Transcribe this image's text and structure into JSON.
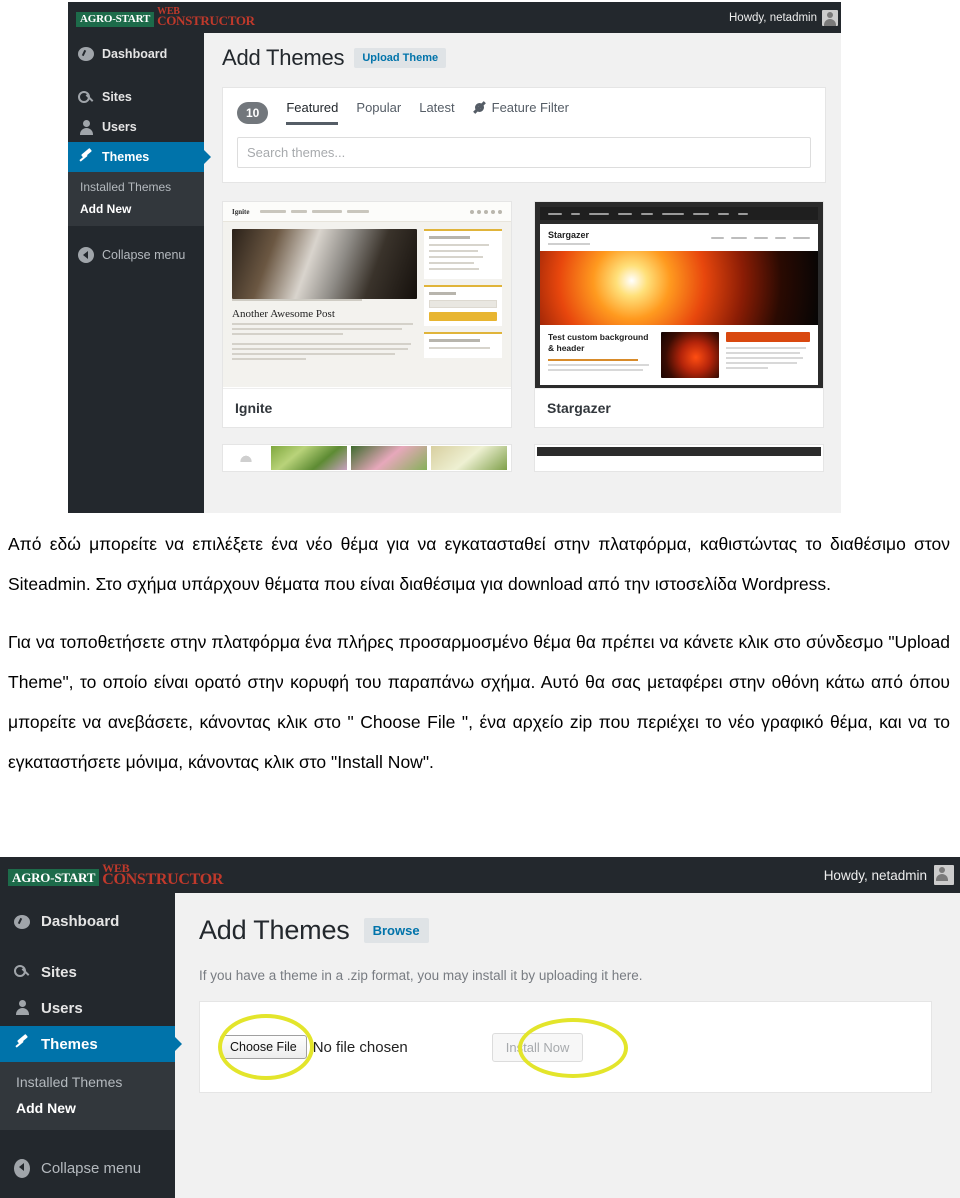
{
  "top_screenshot": {
    "adminbar": {
      "brand_badge": "AGRO-START",
      "brand_line1": "WEB",
      "brand_line2": "CONSTRUCTOR",
      "howdy": "Howdy, netadmin",
      "avatar_icon": "user-avatar-icon"
    },
    "sidebar": {
      "items": [
        {
          "label": "Dashboard",
          "icon": "dashboard-icon",
          "active": false
        },
        {
          "label": "Sites",
          "icon": "key-icon",
          "active": false
        },
        {
          "label": "Users",
          "icon": "users-icon",
          "active": false
        },
        {
          "label": "Themes",
          "icon": "pin-icon",
          "active": true
        }
      ],
      "submenu": [
        {
          "label": "Installed Themes",
          "current": false
        },
        {
          "label": "Add New",
          "current": true
        }
      ],
      "collapse": {
        "label": "Collapse menu",
        "icon": "collapse-arrow-icon"
      }
    },
    "page_title": "Add Themes",
    "page_action": "Upload Theme",
    "count_badge": "10",
    "tabs": [
      {
        "label": "Featured",
        "active": true
      },
      {
        "label": "Popular",
        "active": false
      },
      {
        "label": "Latest",
        "active": false
      }
    ],
    "feature_filter": {
      "label": "Feature Filter",
      "icon": "gear-icon"
    },
    "search_placeholder": "Search themes...",
    "themes": [
      {
        "name": "Ignite",
        "preview_logo": "Ignite",
        "preview_headline": "Another Awesome Post"
      },
      {
        "name": "Stargazer",
        "preview_logo": "Stargazer",
        "preview_headline": "Test custom background & header"
      }
    ]
  },
  "body_text": {
    "paragraph1": "Από εδώ μπορείτε να επιλέξετε ένα νέο θέμα για να εγκατασταθεί στην πλατφόρμα, καθιστώντας το διαθέσιμο στον Siteadmin. Στο σχήμα υπάρχουν θέματα που είναι διαθέσιμα για download από την ιστοσελίδα Wordpress.",
    "paragraph2": "Για να τοποθετήσετε στην πλατφόρμα ένα πλήρες προσαρμοσμένο θέμα θα πρέπει να κάνετε κλικ στο σύνδεσμο \"Upload Theme\", το οποίο είναι ορατό στην κορυφή του παραπάνω σχήμα. Αυτό θα σας μεταφέρει στην οθόνη κάτω από όπου μπορείτε να ανεβάσετε, κάνοντας κλικ στο \" Choose File \", ένα αρχείο zip που περιέχει το νέο γραφικό θέμα, και να το εγκαταστήσετε μόνιμα, κάνοντας κλικ στο \"Install Now\"."
  },
  "bottom_screenshot": {
    "adminbar": {
      "brand_badge": "AGRO-START",
      "brand_line1": "WEB",
      "brand_line2": "CONSTRUCTOR",
      "howdy": "Howdy, netadmin",
      "avatar_icon": "user-avatar-icon"
    },
    "sidebar": {
      "items": [
        {
          "label": "Dashboard",
          "icon": "dashboard-icon",
          "active": false
        },
        {
          "label": "Sites",
          "icon": "key-icon",
          "active": false
        },
        {
          "label": "Users",
          "icon": "users-icon",
          "active": false
        },
        {
          "label": "Themes",
          "icon": "pin-icon",
          "active": true
        }
      ],
      "submenu": [
        {
          "label": "Installed Themes",
          "current": false
        },
        {
          "label": "Add New",
          "current": true
        }
      ],
      "collapse": {
        "label": "Collapse menu",
        "icon": "collapse-arrow-icon"
      }
    },
    "page_title": "Add Themes",
    "page_action": "Browse",
    "note": "If you have a theme in a .zip format, you may install it by uploading it here.",
    "choose_file_button": "Choose File",
    "file_status": "No file chosen",
    "install_button": "Install Now",
    "highlight_color": "#e3e52b"
  }
}
